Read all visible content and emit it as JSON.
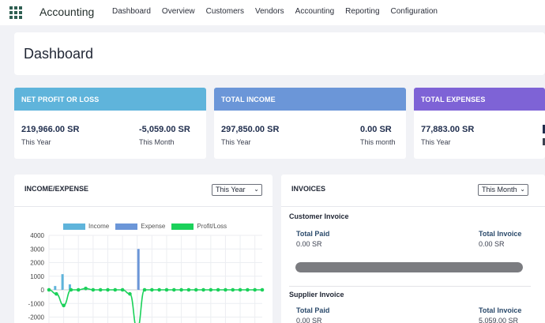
{
  "app": {
    "title": "Accounting",
    "apps_icon": "grid-icon"
  },
  "nav": [
    "Dashboard",
    "Overview",
    "Customers",
    "Vendors",
    "Accounting",
    "Reporting",
    "Configuration"
  ],
  "page": {
    "title": "Dashboard"
  },
  "stats": [
    {
      "title": "NET PROFIT OR LOSS",
      "color": "#5fb4db",
      "left_value": "219,966.00 SR",
      "left_label": "This Year",
      "right_value": "-5,059.00 SR",
      "right_label": "This Month"
    },
    {
      "title": "TOTAL INCOME",
      "color": "#6b96d8",
      "left_value": "297,850.00 SR",
      "left_label": "This Year",
      "right_value": "0.00 SR",
      "right_label": "This month"
    },
    {
      "title": "TOTAL EXPENSES",
      "color": "#7e63d6",
      "left_value": "77,883.00 SR",
      "left_label": "This Year"
    }
  ],
  "income_expense": {
    "title": "INCOME/EXPENSE",
    "period": "This Year",
    "chart_data": {
      "type": "bar",
      "series": [
        {
          "name": "Income",
          "color": "#5fb4db",
          "values": [
            0,
            280,
            1150,
            400,
            0,
            0,
            0,
            0,
            0,
            0,
            0,
            0,
            0,
            0,
            0,
            0,
            0,
            0,
            0,
            0,
            0,
            0,
            0,
            0,
            0,
            0,
            0,
            0,
            0,
            0
          ]
        },
        {
          "name": "Expense",
          "color": "#6b96d8",
          "values": [
            0,
            0,
            0,
            0,
            0,
            0,
            0,
            0,
            0,
            0,
            0,
            0,
            3000,
            0,
            0,
            0,
            0,
            0,
            0,
            0,
            0,
            0,
            0,
            0,
            0,
            0,
            0,
            0,
            0,
            0
          ]
        },
        {
          "name": "Profit/Loss",
          "color": "#1bd15a",
          "values": [
            0,
            -300,
            -1150,
            0,
            0,
            100,
            0,
            0,
            0,
            0,
            0,
            -300,
            -2900,
            0,
            0,
            0,
            0,
            0,
            0,
            0,
            0,
            0,
            0,
            0,
            0,
            0,
            0,
            0,
            0,
            0
          ]
        }
      ],
      "ylim": [
        -2000,
        4000
      ],
      "yticks": [
        4000,
        3000,
        2000,
        1000,
        0,
        -1000,
        -2000
      ],
      "grid": true,
      "legend": "top"
    }
  },
  "invoices": {
    "title": "INVOICES",
    "period": "This Month",
    "customer": {
      "title": "Customer Invoice",
      "paid_label": "Total Paid",
      "paid_value": "0.00 SR",
      "total_label": "Total Invoice",
      "total_value": "0.00 SR",
      "progress": 0
    },
    "supplier": {
      "title": "Supplier Invoice",
      "paid_label": "Total Paid",
      "paid_value": "0.00 SR",
      "total_label": "Total Invoice",
      "total_value": "5,059.00 SR"
    }
  }
}
